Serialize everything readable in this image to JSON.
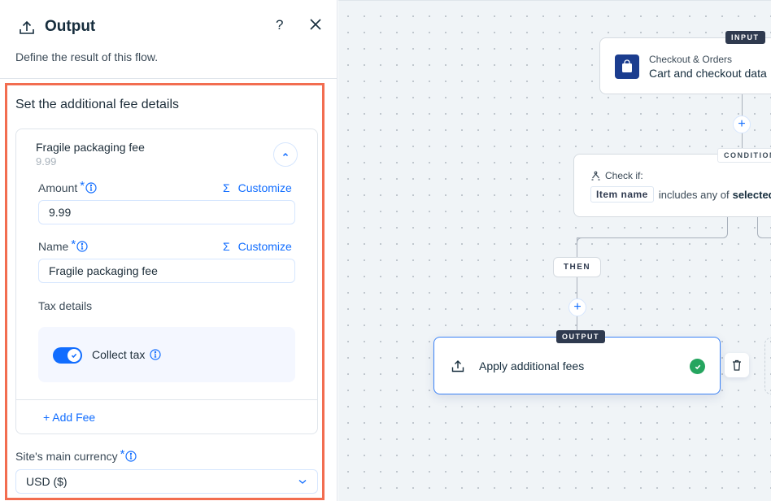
{
  "panel": {
    "title": "Output",
    "subtitle": "Define the result of this flow.",
    "help_label": "?",
    "section_title": "Set the additional fee details",
    "fee": {
      "name": "Fragile packaging fee",
      "amount_preview": "9.99",
      "amount_label": "Amount",
      "amount_required": "*",
      "amount_value": "9.99",
      "name_label": "Name",
      "name_required": "*",
      "name_value": "Fragile packaging fee",
      "customize_label": "Customize",
      "sigma": "Σ",
      "tax_label": "Tax details",
      "collect_tax_label": "Collect tax",
      "collect_tax_on": true
    },
    "add_fee_label": "+ Add Fee",
    "currency_label": "Site's main currency",
    "currency_required": "*",
    "currency_value": "USD ($)"
  },
  "canvas": {
    "input_node": {
      "tag": "INPUT",
      "subtitle": "Checkout & Orders",
      "title": "Cart and checkout data"
    },
    "condition_node": {
      "tag": "CONDITION",
      "check_label": "Check if:",
      "field_chip": "Item name",
      "operator": "includes any of",
      "value": "selected"
    },
    "then_label": "THEN",
    "plus_label": "+",
    "output_node": {
      "tag": "OUTPUT",
      "title": "Apply additional fees",
      "status": "complete"
    }
  },
  "colors": {
    "accent": "#116dff",
    "highlight_border": "#f26d50",
    "success": "#25a55f",
    "tag_dark": "#2f3a4f"
  }
}
